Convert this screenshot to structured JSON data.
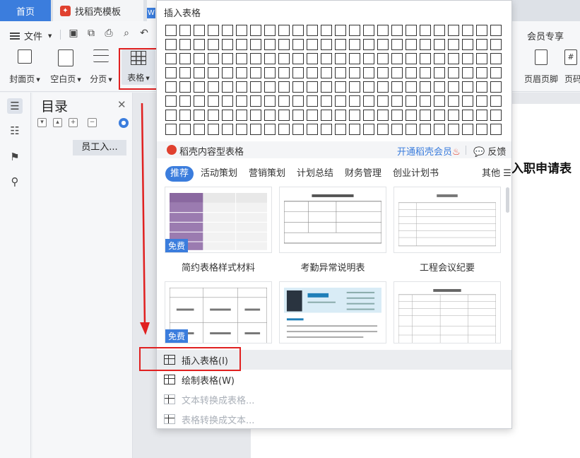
{
  "tabs": [
    {
      "label": "首页",
      "active": true
    },
    {
      "label": "找稻壳模板",
      "active": false
    }
  ],
  "toolbar": {
    "file_label": "文件",
    "member_label": "会员专享",
    "buttons": [
      {
        "label": "封面页"
      },
      {
        "label": "空白页"
      },
      {
        "label": "分页"
      },
      {
        "label": "表格"
      },
      {
        "label": "页眉页脚"
      },
      {
        "label": "页码"
      }
    ]
  },
  "toc": {
    "title": "目录",
    "item_label": "员工入..."
  },
  "document": {
    "heading": "入职申请表"
  },
  "dropdown": {
    "title": "插入表格",
    "grid": {
      "columns": 24,
      "rows": 8
    },
    "recommend_label": "稻壳内容型表格",
    "vip_label": "开通稻壳会员",
    "feedback_label": "反馈",
    "categories": [
      "推荐",
      "活动策划",
      "营销策划",
      "计划总结",
      "财务管理",
      "创业计划书"
    ],
    "more_label": "其他",
    "free_badge": "免费",
    "templates": [
      {
        "caption": "简约表格样式材料"
      },
      {
        "caption": "考勤异常说明表"
      },
      {
        "caption": "工程会议纪要"
      }
    ],
    "menu": [
      {
        "label": "插入表格(I)",
        "enabled": true
      },
      {
        "label": "绘制表格(W)",
        "enabled": true
      },
      {
        "label": "文本转换成表格...",
        "enabled": false
      },
      {
        "label": "表格转换成文本...",
        "enabled": false
      }
    ]
  },
  "colors": {
    "accent": "#3b7ddd",
    "annotation_red": "#e02020",
    "brand_red": "#e0412f"
  },
  "icons": [
    "hamburger-icon",
    "save-icon",
    "export-icon",
    "print-icon",
    "preview-icon",
    "undo-icon",
    "toc-icon",
    "navigation-icon",
    "bookmark-icon",
    "search-icon",
    "close-icon",
    "table-grid-icon",
    "draw-table-icon",
    "flame-icon",
    "feedback-icon"
  ]
}
